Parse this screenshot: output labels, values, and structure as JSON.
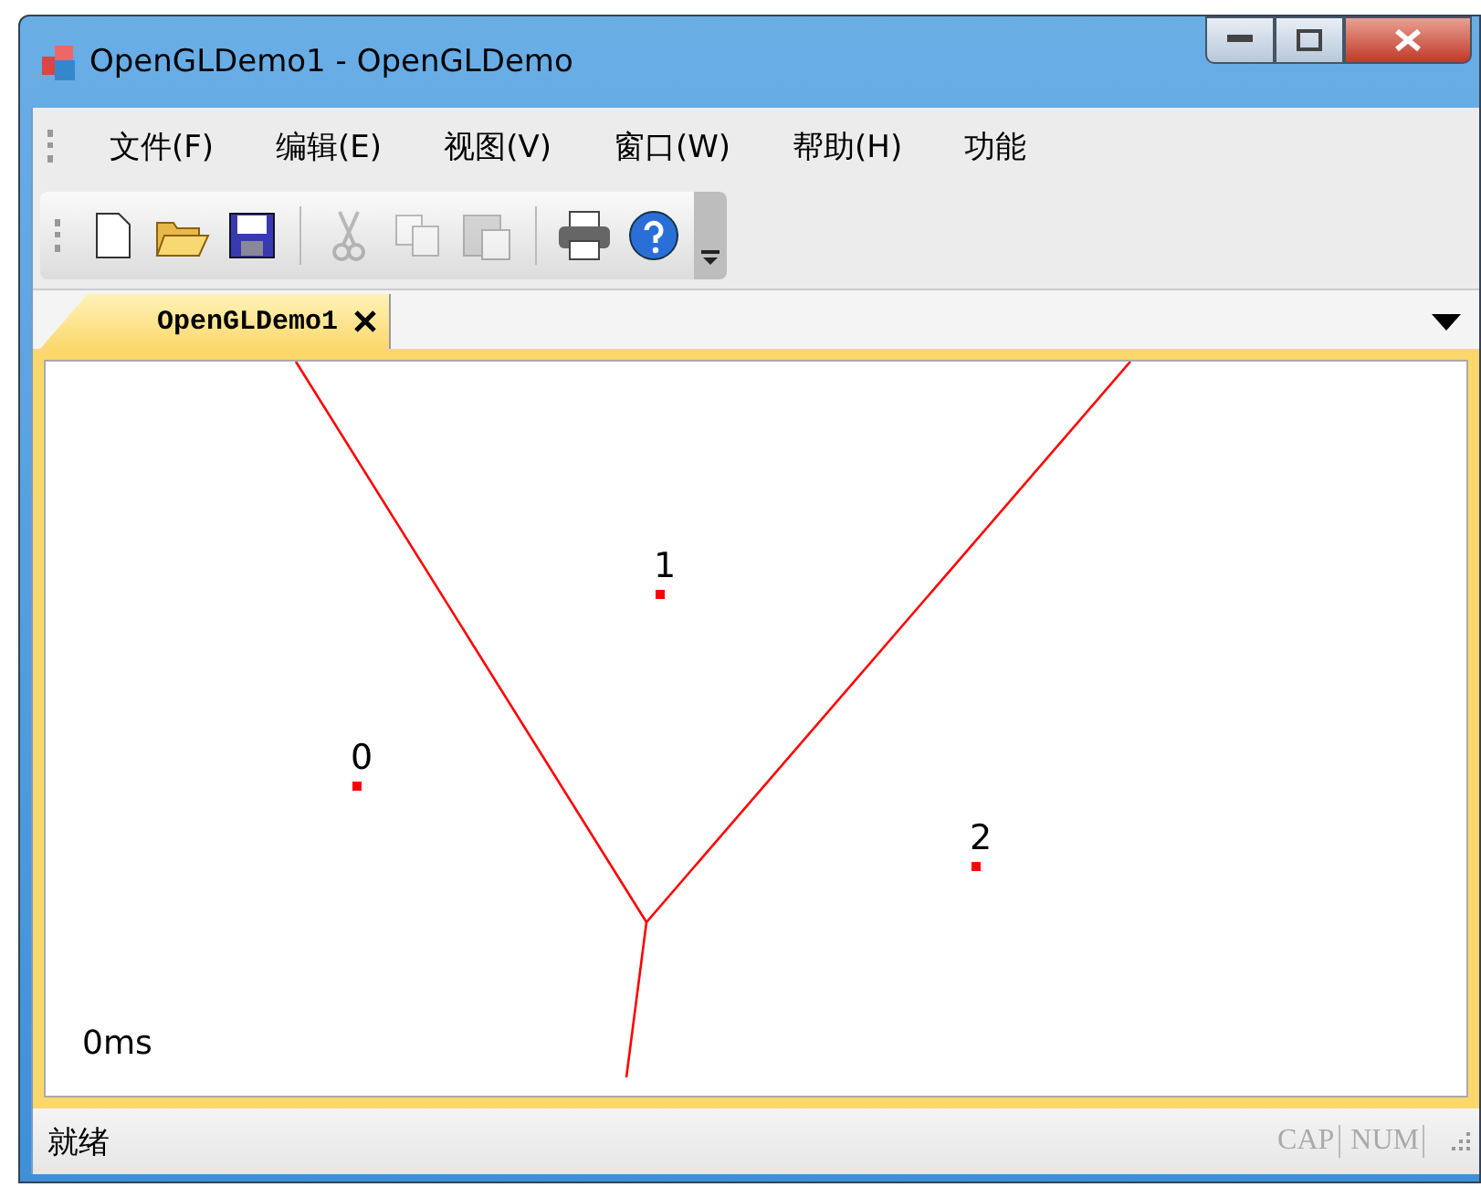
{
  "window": {
    "title": "OpenGLDemo1 - OpenGLDemo"
  },
  "menu": [
    "文件(F)",
    "编辑(E)",
    "视图(V)",
    "窗口(W)",
    "帮助(H)",
    "功能"
  ],
  "toolbar": [
    {
      "kind": "new",
      "disabled": false
    },
    {
      "kind": "open",
      "disabled": false
    },
    {
      "kind": "save",
      "disabled": false
    },
    {
      "kind": "separator"
    },
    {
      "kind": "cut",
      "disabled": true
    },
    {
      "kind": "copy",
      "disabled": true
    },
    {
      "kind": "paste",
      "disabled": true
    },
    {
      "kind": "separator"
    },
    {
      "kind": "print",
      "disabled": false
    },
    {
      "kind": "help",
      "disabled": false
    }
  ],
  "tabs": [
    {
      "label": "OpenGLDemo1",
      "selected": true
    }
  ],
  "canvas": {
    "points": [
      {
        "label": "0"
      },
      {
        "label": "1"
      },
      {
        "label": "2"
      }
    ],
    "timing": "0ms"
  },
  "status_bar": {
    "message": "就绪",
    "indicators": [
      {
        "label": "CAP",
        "on": false
      },
      {
        "label": "NUM",
        "on": false
      }
    ]
  }
}
